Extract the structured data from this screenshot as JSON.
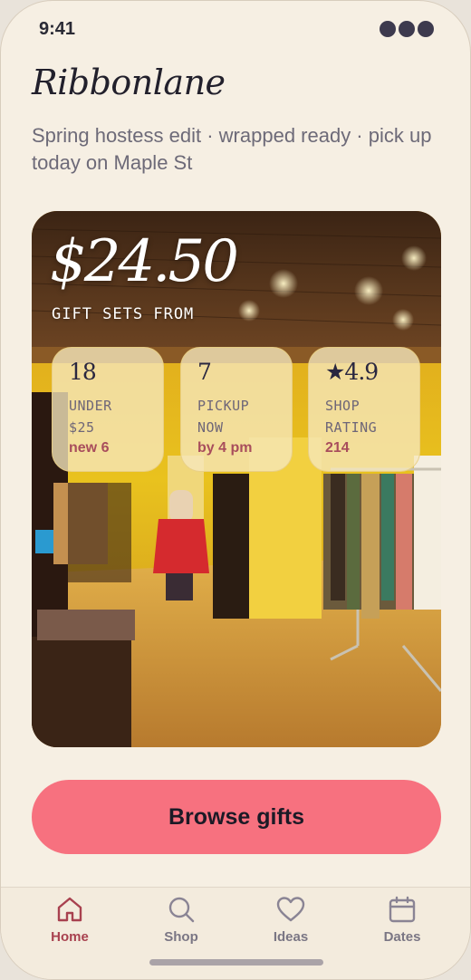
{
  "status": {
    "time": "9:41"
  },
  "brand": "Ribbonlane",
  "subtitle": "Spring hostess edit · wrapped ready · pick up today on Maple St",
  "hero": {
    "price": "$24.50",
    "caption": "GIFT SETS FROM",
    "image": "boutique-interior-photo",
    "stats": [
      {
        "num": "18",
        "label_line1": "UNDER",
        "label_line2": "$25",
        "sub": "new 6"
      },
      {
        "num": "7",
        "label_line1": "PICKUP",
        "label_line2": "NOW",
        "sub": "by 4 pm"
      },
      {
        "num": "★4.9",
        "label_line1": "SHOP",
        "label_line2": "RATING",
        "sub": "214"
      }
    ]
  },
  "cta": {
    "label": "Browse gifts"
  },
  "tabs": [
    {
      "label": "Home",
      "icon": "home-icon",
      "active": true
    },
    {
      "label": "Shop",
      "icon": "search-icon",
      "active": false
    },
    {
      "label": "Ideas",
      "icon": "heart-icon",
      "active": false
    },
    {
      "label": "Dates",
      "icon": "calendar-icon",
      "active": false
    }
  ],
  "colors": {
    "background": "#f6efe3",
    "accent": "#f7717f",
    "active_tab": "#a8414f",
    "stat_sub": "#a84d5c"
  }
}
